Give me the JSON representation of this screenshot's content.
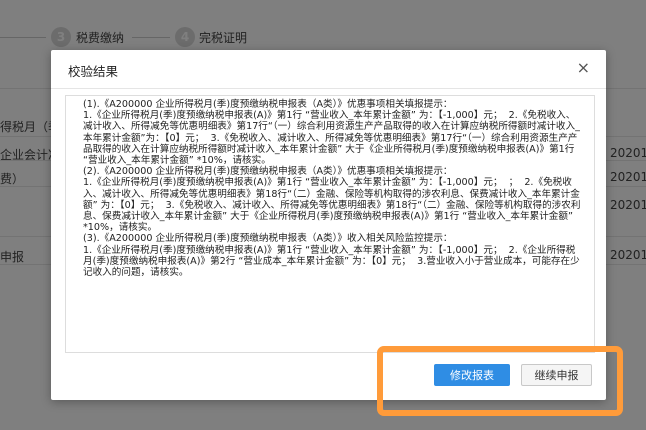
{
  "steps": [
    {
      "num": "3",
      "label": "税费缴纳"
    },
    {
      "num": "4",
      "label": "完税证明"
    }
  ],
  "background_texts": {
    "row1": "得税月（季",
    "row2": "企业会计准",
    "row3": "费）",
    "row4": "申报",
    "col_right": [
      "20201",
      "20201",
      "20201",
      "20201"
    ]
  },
  "dialog": {
    "title": "校验结果",
    "close_symbol": "×",
    "content": [
      "(1).《A200000 企业所得税月(季)度预缴纳税申报表（A类）》优惠事项相关填报提示：",
      "1.《企业所得税月(季)度预缴纳税申报表(A)》第1行 “营业收入_本年累计金额” 为：【-1,000】元；  2.《免税收入、减计收入、所得减免等优惠明细表》第17行“（一）综合利用资源生产产品取得的收入在计算应纳税所得额时减计收入_本年累计金额”为：【0】元；  3.《免税收入、减计收入、所得减免等优惠明细表》第17行“（一）综合利用资源生产产品取得的收入在计算应纳税所得额时减计收入_本年累计金额” 大于《企业所得税月(季)度预缴纳税申报表(A)》第1行 “营业收入_本年累计金额” *10%，请核实。",
      "(2).《A200000 企业所得税月(季)度预缴纳税申报表（A类）》优惠事项相关填报提示：",
      "1.《企业所得税月(季)度预缴纳税申报表(A)》第1行 “营业收入_本年累计金额” 为：【-1,000】元；  ；  2.《免税收入、减计收入、所得减免等优惠明细表》第18行“（二）金融、保险等机构取得的涉农利息、保费减计收入_本年累计金额” 为：【0】元；  3.《免税收入、减计收入、所得减免等优惠明细表》第18行“（二）金融、保险等机构取得的涉农利息、保费减计收入_本年累计金额” 大于《企业所得税月(季)度预缴纳税申报表(A)》第1行 “营业收入_本年累计金额” *10%，请核实。",
      "(3).《A200000 企业所得税月(季)度预缴纳税申报表（A类）》收入相关风险监控提示：",
      "1.《企业所得税月(季)度预缴纳税申报表(A)》第1行 “营业收入_本年累计金额” 为：【-1,000】元；  2.《企业所得税月(季)度预缴纳税申报表(A)》第2行 “营业成本_本年累计金额” 为：【0】元；  3.营业收入小于营业成本，可能存在少记收入的问题，请核实。"
    ],
    "buttons": {
      "modify": "修改报表",
      "continue": "继续申报"
    }
  },
  "colors": {
    "primary": "#2f8de4",
    "highlight": "#ff9b3a"
  }
}
